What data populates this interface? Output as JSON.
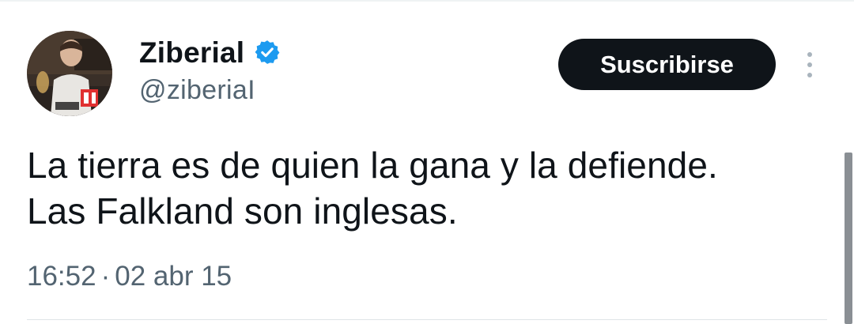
{
  "tweet": {
    "author": {
      "display_name": "Ziberial",
      "handle": "@ziberiaI",
      "verified": true,
      "verified_icon": "verified-badge-icon",
      "verified_color": "#1d9bf0"
    },
    "subscribe_label": "Suscribirse",
    "more_icon": "more-vertical-icon",
    "text_lines": [
      "La tierra es de quien la gana y la defiende.",
      "Las Falkland son inglesas."
    ],
    "time": "16:52",
    "separator": "·",
    "date": "02 abr 15"
  },
  "colors": {
    "text": "#0f1419",
    "secondary": "#536471",
    "button_bg": "#0f1419",
    "button_text": "#ffffff"
  }
}
